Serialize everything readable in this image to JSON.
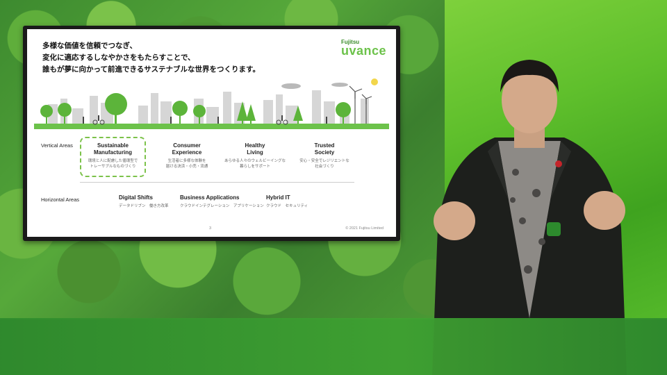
{
  "slide": {
    "headline": [
      "多様な価値を信頼でつなぎ、",
      "変化に適応するしなやかさをもたらすことで、",
      "誰もが夢に向かって前進できるサステナブルな世界をつくります。"
    ],
    "logo": {
      "top": "Fujitsu",
      "main": "uvance",
      "color": "#6cc24a"
    },
    "vertical_label": "Vertical Areas",
    "vertical_items": [
      {
        "title_1": "Sustainable",
        "title_2": "Manufacturing",
        "sub_1": "環境と人に配慮した循環型で",
        "sub_2": "トレーサブルなものづくり",
        "highlighted": true
      },
      {
        "title_1": "Consumer",
        "title_2": "Experience",
        "sub_1": "生活者に多様な体験を",
        "sub_2": "届ける決済・小売・流通"
      },
      {
        "title_1": "Healthy",
        "title_2": "Living",
        "sub_1": "あらゆる人々のウェルビーイングな",
        "sub_2": "暮らしをサポート"
      },
      {
        "title_1": "Trusted",
        "title_2": "Society",
        "sub_1": "安心・安全でレジリエントな",
        "sub_2": "社会づくり"
      }
    ],
    "horizontal_label": "Horizontal Areas",
    "horizontal_items": [
      {
        "title": "Digital Shifts",
        "sub": "データドリブン　働き方改革"
      },
      {
        "title": "Business Applications",
        "sub": "クラウドインテグレーション　アプリケーション"
      },
      {
        "title": "Hybrid IT",
        "sub": "クラウド　セキュリティ"
      }
    ],
    "page_number": "3",
    "copyright": "© 2021 Fujitsu Limited"
  },
  "colors": {
    "accent_green": "#6cc24a",
    "highlight_dashed": "#7cc24a"
  }
}
